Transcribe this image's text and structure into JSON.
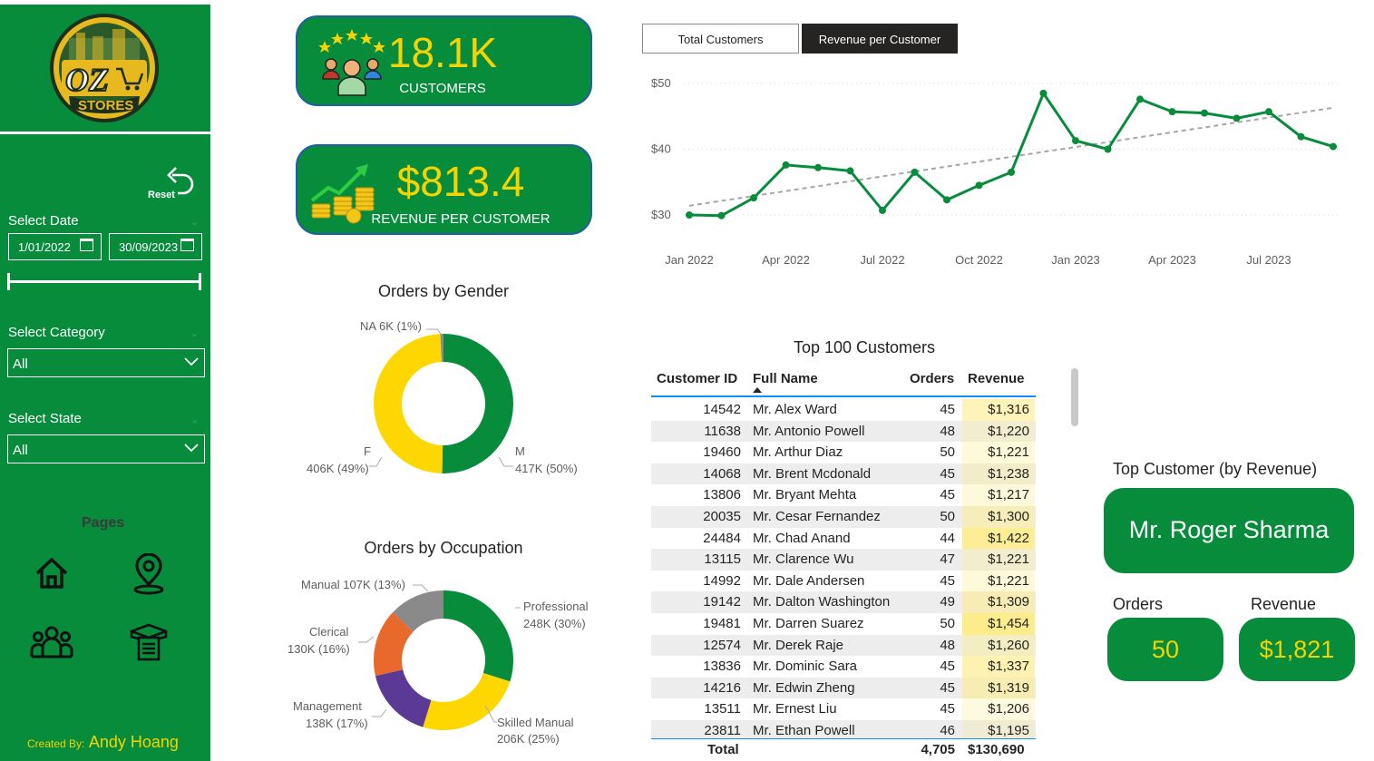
{
  "sidebar": {
    "logo_text": "OZ STORES",
    "reset_label": "Reset",
    "date_label": "Select Date",
    "date_start": "1/01/2022",
    "date_end": "30/09/2023",
    "category_label": "Select Category",
    "category_value": "All",
    "state_label": "Select State",
    "state_value": "All",
    "pages_label": "Pages",
    "credit_prefix": "Created By:",
    "credit_name": "Andy Hoang"
  },
  "kpis": {
    "customers_value": "18.1K",
    "customers_label": "CUSTOMERS",
    "revenue_value": "$813.4",
    "revenue_label": "REVENUE PER CUSTOMER"
  },
  "tabs": {
    "total_customers": "Total Customers",
    "revenue_per_customer": "Revenue per Customer",
    "active": "Revenue per Customer"
  },
  "colors": {
    "brand_green": "#078c3c",
    "accent_yellow": "#f5d400",
    "highlight_yellow": "#fdf1a6",
    "male": "#078c3c",
    "female": "#ffd700",
    "na": "#8a8a8a",
    "professional": "#078c3c",
    "skilled_manual": "#ffd700",
    "management": "#5b3a96",
    "clerical": "#e8692b",
    "manual": "#8a8a8a"
  },
  "chart_data": [
    {
      "type": "line",
      "x": [
        "Jan 2022",
        "Feb 2022",
        "Mar 2022",
        "Apr 2022",
        "May 2022",
        "Jun 2022",
        "Jul 2022",
        "Aug 2022",
        "Sep 2022",
        "Oct 2022",
        "Nov 2022",
        "Dec 2022",
        "Jan 2023",
        "Feb 2023",
        "Mar 2023",
        "Apr 2023",
        "May 2023",
        "Jun 2023",
        "Jul 2023",
        "Aug 2023",
        "Sep 2023"
      ],
      "series": [
        {
          "values": [
            30.0,
            29.9,
            32.6,
            37.6,
            37.2,
            36.7,
            30.7,
            36.5,
            32.3,
            34.5,
            36.5,
            48.5,
            41.3,
            40.0,
            47.6,
            45.7,
            45.5,
            44.7,
            45.7,
            41.9,
            40.4
          ]
        }
      ],
      "trendline": {
        "style": "dashed",
        "start": 31.4,
        "end": 46.3
      },
      "x_tick_labels": [
        "Jan 2022",
        "Apr 2022",
        "Jul 2022",
        "Oct 2022",
        "Jan 2023",
        "Apr 2023",
        "Jul 2023"
      ],
      "y_tick_labels": [
        "$30",
        "$40",
        "$50"
      ],
      "ylim": [
        30,
        50
      ],
      "grid": "dotted horizontal"
    },
    {
      "type": "pie",
      "title": "Orders by Gender",
      "labels": [
        "M",
        "F",
        "NA"
      ],
      "values": [
        417,
        406,
        6
      ],
      "value_labels": [
        "417K (50%)",
        "406K (49%)",
        "6K (1%)"
      ]
    },
    {
      "type": "pie",
      "title": "Orders by Occupation",
      "labels": [
        "Professional",
        "Skilled Manual",
        "Management",
        "Clerical",
        "Manual"
      ],
      "values": [
        248,
        206,
        138,
        130,
        107
      ],
      "value_labels": [
        "248K (30%)",
        "206K (25%)",
        "138K (17%)",
        "130K (16%)",
        "107K (13%)"
      ]
    },
    {
      "type": "table",
      "title": "Top 100 Customers",
      "columns": [
        "Customer ID",
        "Full Name",
        "Orders",
        "Revenue"
      ],
      "rows": [
        [
          "14542",
          "Mr. Alex Ward",
          "45",
          "$1,316"
        ],
        [
          "11638",
          "Mr. Antonio Powell",
          "48",
          "$1,220"
        ],
        [
          "19460",
          "Mr. Arthur Diaz",
          "50",
          "$1,221"
        ],
        [
          "14068",
          "Mr. Brent Mcdonald",
          "45",
          "$1,238"
        ],
        [
          "13806",
          "Mr. Bryant Mehta",
          "45",
          "$1,217"
        ],
        [
          "20035",
          "Mr. Cesar Fernandez",
          "50",
          "$1,300"
        ],
        [
          "24484",
          "Mr. Chad Anand",
          "44",
          "$1,422"
        ],
        [
          "13115",
          "Mr. Clarence Wu",
          "47",
          "$1,221"
        ],
        [
          "14992",
          "Mr. Dale Andersen",
          "45",
          "$1,221"
        ],
        [
          "19142",
          "Mr. Dalton Washington",
          "49",
          "$1,309"
        ],
        [
          "19481",
          "Mr. Darren Suarez",
          "50",
          "$1,454"
        ],
        [
          "12574",
          "Mr. Derek Raje",
          "48",
          "$1,260"
        ],
        [
          "13836",
          "Mr. Dominic Sara",
          "45",
          "$1,337"
        ],
        [
          "14216",
          "Mr. Edwin Zheng",
          "45",
          "$1,319"
        ],
        [
          "13511",
          "Mr. Ernest Liu",
          "45",
          "$1,206"
        ],
        [
          "23811",
          "Mr. Ethan Powell",
          "46",
          "$1,195"
        ]
      ],
      "total": {
        "label": "Total",
        "orders": "4,705",
        "revenue": "$130,690"
      }
    }
  ],
  "top_customer": {
    "title": "Top Customer (by Revenue)",
    "name": "Mr. Roger Sharma",
    "orders_label": "Orders",
    "orders_value": "50",
    "revenue_label": "Revenue",
    "revenue_value": "$1,821"
  }
}
